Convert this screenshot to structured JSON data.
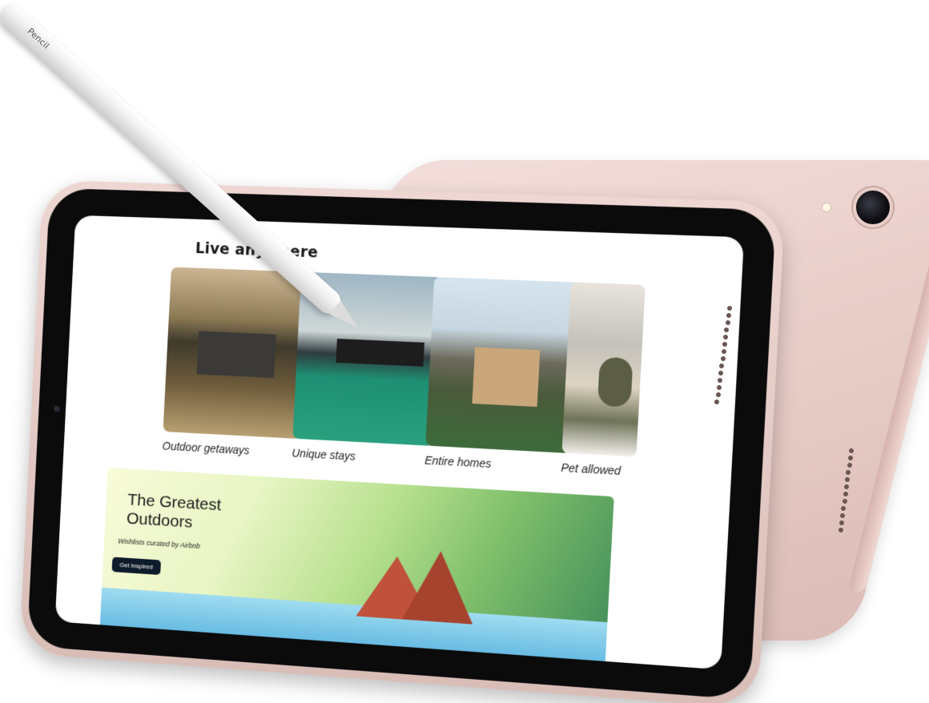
{
  "screen": {
    "heading": "Live anywhere",
    "categories": [
      {
        "label": "Outdoor getaways"
      },
      {
        "label": "Unique stays"
      },
      {
        "label": "Entire homes"
      },
      {
        "label": "Pet allowed"
      }
    ],
    "banner": {
      "title": "The Greatest Outdoors",
      "subtitle": "Wishlists curated by Airbnb",
      "button_label": "Get Inspired"
    }
  },
  "pencil": {
    "engraving": "Pencil"
  },
  "colors": {
    "device": "#e9cfca",
    "bezel": "#0b0b0c",
    "button": "#0d1b2a"
  }
}
